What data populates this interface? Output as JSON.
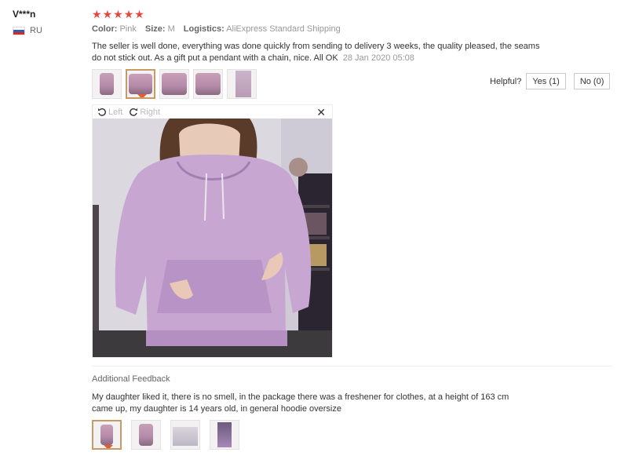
{
  "review": {
    "username": "V***n",
    "country": "RU",
    "rating": 5,
    "stars": [
      "★",
      "★",
      "★",
      "★",
      "★"
    ],
    "color_label": "Color:",
    "color_value": "Pink",
    "size_label": "Size:",
    "size_value": "M",
    "logistics_label": "Logistics:",
    "logistics_value": "AliExpress Standard Shipping",
    "text": "The seller is well done, everything was done quickly from sending to delivery 3 weeks, the quality pleased, the seams do not stick out. As a gift put a pendant with a chain, nice. All OK",
    "date": "28 Jan 2020 05:08"
  },
  "helpful": {
    "label": "Helpful?",
    "yes_label": "Yes (1)",
    "no_label": "No (0)"
  },
  "viewer": {
    "rotate_left_label": "Left",
    "rotate_right_label": "Right",
    "close_symbol": "✕"
  },
  "additional": {
    "label": "Additional Feedback",
    "text": "My daughter liked it, there is no smell, in the package there was a freshener for clothes, at a height of 163 cm came up, my daughter is 14 years old, in general hoodie oversize"
  },
  "colors": {
    "star": "#e8463d",
    "selected_thumb_border": "#c59b68",
    "pointer": "#e35e2c"
  }
}
